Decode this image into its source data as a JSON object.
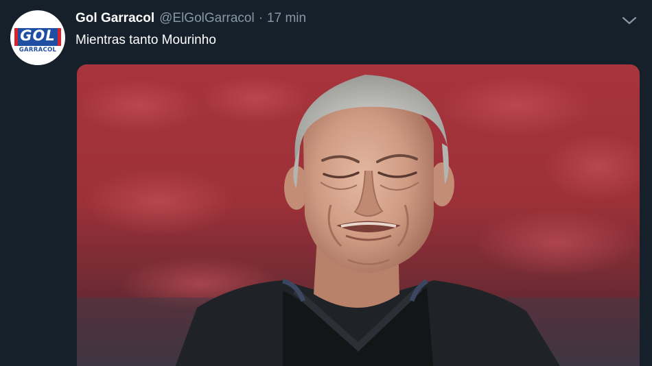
{
  "tweet": {
    "display_name": "Gol Garracol",
    "handle": "@ElGolGarracol",
    "separator": "·",
    "timestamp": "17 min",
    "text": "Mientras tanto Mourinho"
  },
  "avatar": {
    "logo_big": "GOL",
    "logo_small": "GARRACOL"
  },
  "icons": {
    "menu": "chevron-down-icon"
  },
  "colors": {
    "background": "#15202b",
    "secondary_text": "#8899a6",
    "primary_text": "#ffffff",
    "brand_blue": "#1f4fa3",
    "brand_red": "#d8232a"
  }
}
